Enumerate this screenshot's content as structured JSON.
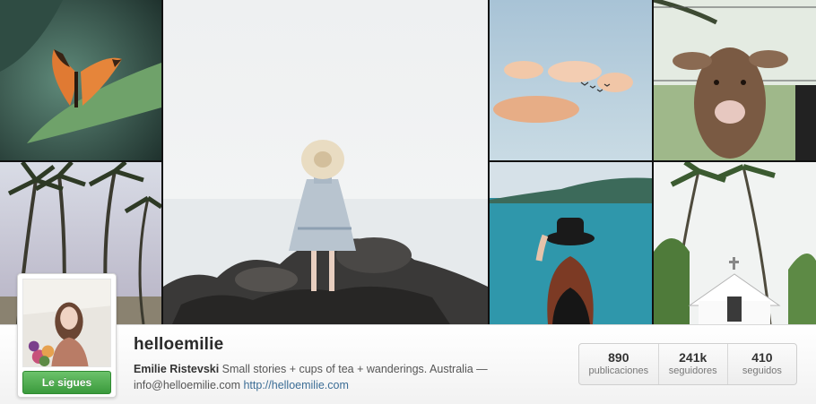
{
  "mosaic": {
    "photos": [
      {
        "name": "photo-butterfly",
        "subject": "butterfly on leaf"
      },
      {
        "name": "photo-palm-trees",
        "subject": "palm trees"
      },
      {
        "name": "photo-woman-on-rocks",
        "subject": "woman in hat on rocks by the sea"
      },
      {
        "name": "photo-clouds-birds",
        "subject": "clouds and birds"
      },
      {
        "name": "photo-calf",
        "subject": "calf in field"
      },
      {
        "name": "photo-woman-lake",
        "subject": "woman in black hat at lake"
      },
      {
        "name": "photo-chapel-palms",
        "subject": "white chapel among palms"
      }
    ]
  },
  "profile": {
    "username": "helloemilie",
    "full_name": "Emilie Ristevski",
    "bio_text": " Small stories + cups of tea + wanderings. Australia — info@helloemilie.com ",
    "website": "http://helloemilie.com",
    "follow_label": "Le sigues"
  },
  "stats": [
    {
      "value": "890",
      "label": "publicaciones"
    },
    {
      "value": "241k",
      "label": "seguidores"
    },
    {
      "value": "410",
      "label": "seguidos"
    }
  ],
  "colors": {
    "follow_green": "#4caf50",
    "link_blue": "#3d6e96"
  }
}
